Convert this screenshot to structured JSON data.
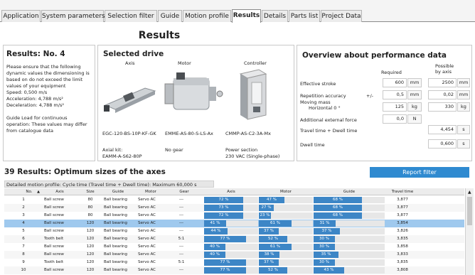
{
  "tabs": [
    "Application",
    "System parameters",
    "Selection filter",
    "Guide",
    "Motion profile",
    "Results",
    "Details",
    "Parts list",
    "Project Data"
  ],
  "page_title": "Results",
  "left": {
    "heading": "Results: No. 4",
    "lines": [
      "Please ensure that the following",
      "dynamic values the dimensioning is",
      "based on do not exceed the limit",
      "values of your equipment",
      "Speed: 0,500 m/s",
      "Acceleration: 4,788 m/s²",
      "Deceleration: 4,788 m/s²"
    ],
    "note": [
      "Guide Load for continuous",
      "operation: These values may differ",
      "from catalogue data"
    ]
  },
  "drive": {
    "heading": "Selected drive",
    "cols": [
      {
        "label": "Axis",
        "type": "EGC-120-BS-10P-KF-GK",
        "k1": "Axial kit:",
        "k2": "EAMM-A-S62-80P"
      },
      {
        "label": "Motor",
        "type": "EMME-AS-80-S-LS-Ax",
        "k1": "No gear",
        "k2": ""
      },
      {
        "label": "Controller",
        "type": "CMMP-AS-C2-3A-Mx",
        "k1": "Power section",
        "k2": "230 VAC (Single-phase)"
      }
    ]
  },
  "perf": {
    "heading": "Overview about performance data",
    "col_required": "Required",
    "col_possible1": "Possible",
    "col_possible2": "by axis",
    "plusminus": "+/-",
    "rows": [
      {
        "label": "Effective stroke",
        "req": "600",
        "unit": "mm",
        "pos": "2500",
        "punit": "mm"
      },
      {
        "label": "Repetition accuracy",
        "req": "0,5",
        "unit": "mm",
        "pos": "0,02",
        "punit": "mm"
      },
      {
        "label": "Moving mass",
        "label2": "Horizontal 0 °",
        "req": "125",
        "unit": "kg",
        "pos": "330",
        "punit": "kg"
      },
      {
        "label": "Additional external force",
        "req": "0,0",
        "unit": "N",
        "pos": "",
        "punit": ""
      }
    ],
    "travel": {
      "label": "Travel time + Dwell time",
      "val": "4,454",
      "unit": "s"
    },
    "dwell": {
      "label": "Dwell time",
      "val": "0,600",
      "unit": "s"
    }
  },
  "results": {
    "heading": "39 Results: Optimum sizes of the axes",
    "filter_button": "Report filter",
    "motion_profile": "Detailed motion profile: Cycle time (Travel time + Dwell time): Maximum 60,000 s",
    "headers": [
      "No.",
      "Axis",
      "Size",
      "Guide",
      "Motor",
      "Gear",
      "Axis",
      "Motor",
      "Guide",
      "Travel time"
    ],
    "selected_row": 4,
    "rows": [
      {
        "no": "1",
        "axis": "Ball screw",
        "size": "80",
        "guide": "Ball bearing",
        "motor": "Servo AC",
        "gear": "---",
        "pa": 72,
        "pm": 47,
        "pg": 68,
        "tt": "3,877"
      },
      {
        "no": "2",
        "axis": "Ball screw",
        "size": "80",
        "guide": "Ball bearing",
        "motor": "Servo AC",
        "gear": "---",
        "pa": 73,
        "pm": 27,
        "pg": 68,
        "tt": "3,877"
      },
      {
        "no": "3",
        "axis": "Ball screw",
        "size": "80",
        "guide": "Ball bearing",
        "motor": "Servo AC",
        "gear": "---",
        "pa": 72,
        "pm": 23,
        "pg": 68,
        "tt": "3,877"
      },
      {
        "no": "4",
        "axis": "Ball screw",
        "size": "120",
        "guide": "Ball bearing",
        "motor": "Servo AC",
        "gear": "---",
        "pa": 41,
        "pm": 61,
        "pg": 31,
        "tt": "3,854"
      },
      {
        "no": "5",
        "axis": "Ball screw",
        "size": "120",
        "guide": "Ball bearing",
        "motor": "Servo AC",
        "gear": "---",
        "pa": 44,
        "pm": 37,
        "pg": 37,
        "tt": "3,826"
      },
      {
        "no": "6",
        "axis": "Tooth belt",
        "size": "120",
        "guide": "Ball bearing",
        "motor": "Servo AC",
        "gear": "5:1",
        "pa": 77,
        "pm": 52,
        "pg": 30,
        "tt": "3,835"
      },
      {
        "no": "7",
        "axis": "Ball screw",
        "size": "120",
        "guide": "Ball bearing",
        "motor": "Servo AC",
        "gear": "---",
        "pa": 40,
        "pm": 61,
        "pg": 30,
        "tt": "3,858"
      },
      {
        "no": "8",
        "axis": "Ball screw",
        "size": "120",
        "guide": "Ball bearing",
        "motor": "Servo AC",
        "gear": "---",
        "pa": 40,
        "pm": 38,
        "pg": 35,
        "tt": "3,833"
      },
      {
        "no": "9",
        "axis": "Tooth belt",
        "size": "120",
        "guide": "Ball bearing",
        "motor": "Servo AC",
        "gear": "5:1",
        "pa": 77,
        "pm": 37,
        "pg": 30,
        "tt": "3,835"
      },
      {
        "no": "10",
        "axis": "Ball screw",
        "size": "120",
        "guide": "Ball bearing",
        "motor": "Servo AC",
        "gear": "---",
        "pa": 77,
        "pm": 52,
        "pg": 43,
        "tt": "3,808"
      }
    ]
  }
}
